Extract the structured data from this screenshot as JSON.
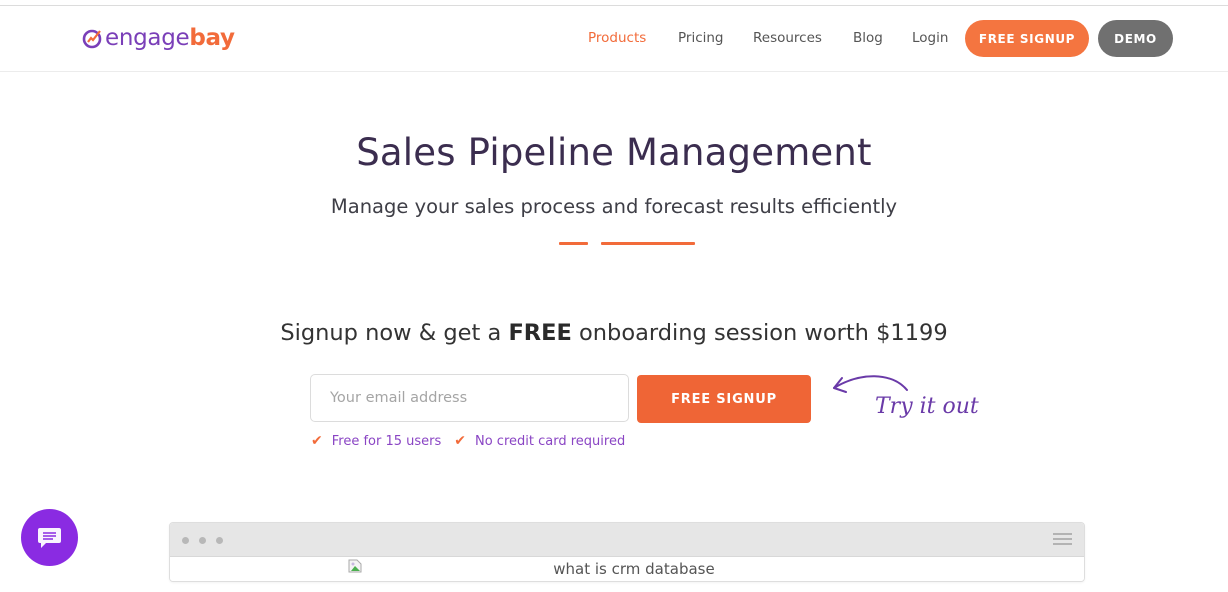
{
  "header": {
    "logo": {
      "part1": "engage",
      "part2": "bay"
    },
    "nav": [
      {
        "label": "Products",
        "active": true
      },
      {
        "label": "Pricing",
        "active": false
      },
      {
        "label": "Resources",
        "active": false
      },
      {
        "label": "Blog",
        "active": false
      },
      {
        "label": "Login",
        "active": false
      }
    ],
    "signup_label": "FREE SIGNUP",
    "demo_label": "DEMO"
  },
  "hero": {
    "title": "Sales Pipeline Management",
    "subtitle": "Manage your sales process and forecast results efficiently"
  },
  "offer": {
    "prefix": "Signup now & get a ",
    "bold": "FREE",
    "suffix": " onboarding session worth $1199"
  },
  "signup_form": {
    "email_placeholder": "Your email address",
    "email_value": "",
    "button_label": "FREE SIGNUP",
    "annotation": "Try it out",
    "perks": [
      "Free for 15 users",
      "No credit card required"
    ]
  },
  "preview": {
    "image_alt": "what is crm database"
  },
  "colors": {
    "brand_orange": "#f26b3a",
    "brand_purple": "#7a3fb8",
    "demo_gray": "#707070",
    "chat_purple": "#8a2be2"
  },
  "icons": {
    "chat": "chat-bubble-icon",
    "check": "checkmark-icon",
    "arrow": "curved-arrow-icon",
    "menu": "hamburger-menu-icon",
    "broken_image": "broken-image-icon"
  }
}
